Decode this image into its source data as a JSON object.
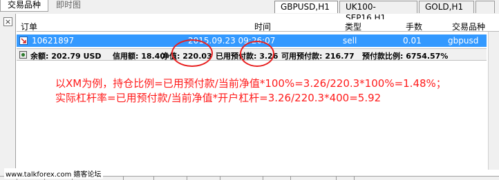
{
  "top_tabs": {
    "left": [
      "交易品种",
      "即时图"
    ],
    "charts": [
      "GBPUSD,H1",
      "UK100-SEP16,H1",
      "GOLD,H1"
    ]
  },
  "table": {
    "headers": {
      "ticket": "订单",
      "time": "时间",
      "type": "类型",
      "lots": "手数",
      "symbol": "交易品种"
    },
    "order": {
      "ticket": "10621897",
      "time": "2015.09.23 09:26:07",
      "type": "sell",
      "lots": "0.01",
      "symbol": "gbpusd"
    },
    "summary": {
      "balance": "余额: 202.79 USD",
      "credit": "信用额: 18.40",
      "equity": "净值: 220.03",
      "margin": "已用预付款: 3.26",
      "free_margin": "可用预付款: 216.77",
      "margin_level": "预付款比例: 6754.57%"
    }
  },
  "annotation": {
    "line1": "以XM为例，持仓比例=已用预付款/当前净值*100%=3.26/220.3*100%=1.48%；",
    "line2": "实际杠杆率=已用预付款/当前净值*开户杠杆=3.26/220.3*400=5.92"
  },
  "watermark": "www.talkforex.com 嬉客论坛",
  "colors": {
    "selection": "#3399ff",
    "annotation": "#ff1a1a",
    "circle": "#e82020"
  },
  "icons": {
    "close": "close-icon",
    "row": "sell-order-icon",
    "summary": "balance-icon"
  }
}
